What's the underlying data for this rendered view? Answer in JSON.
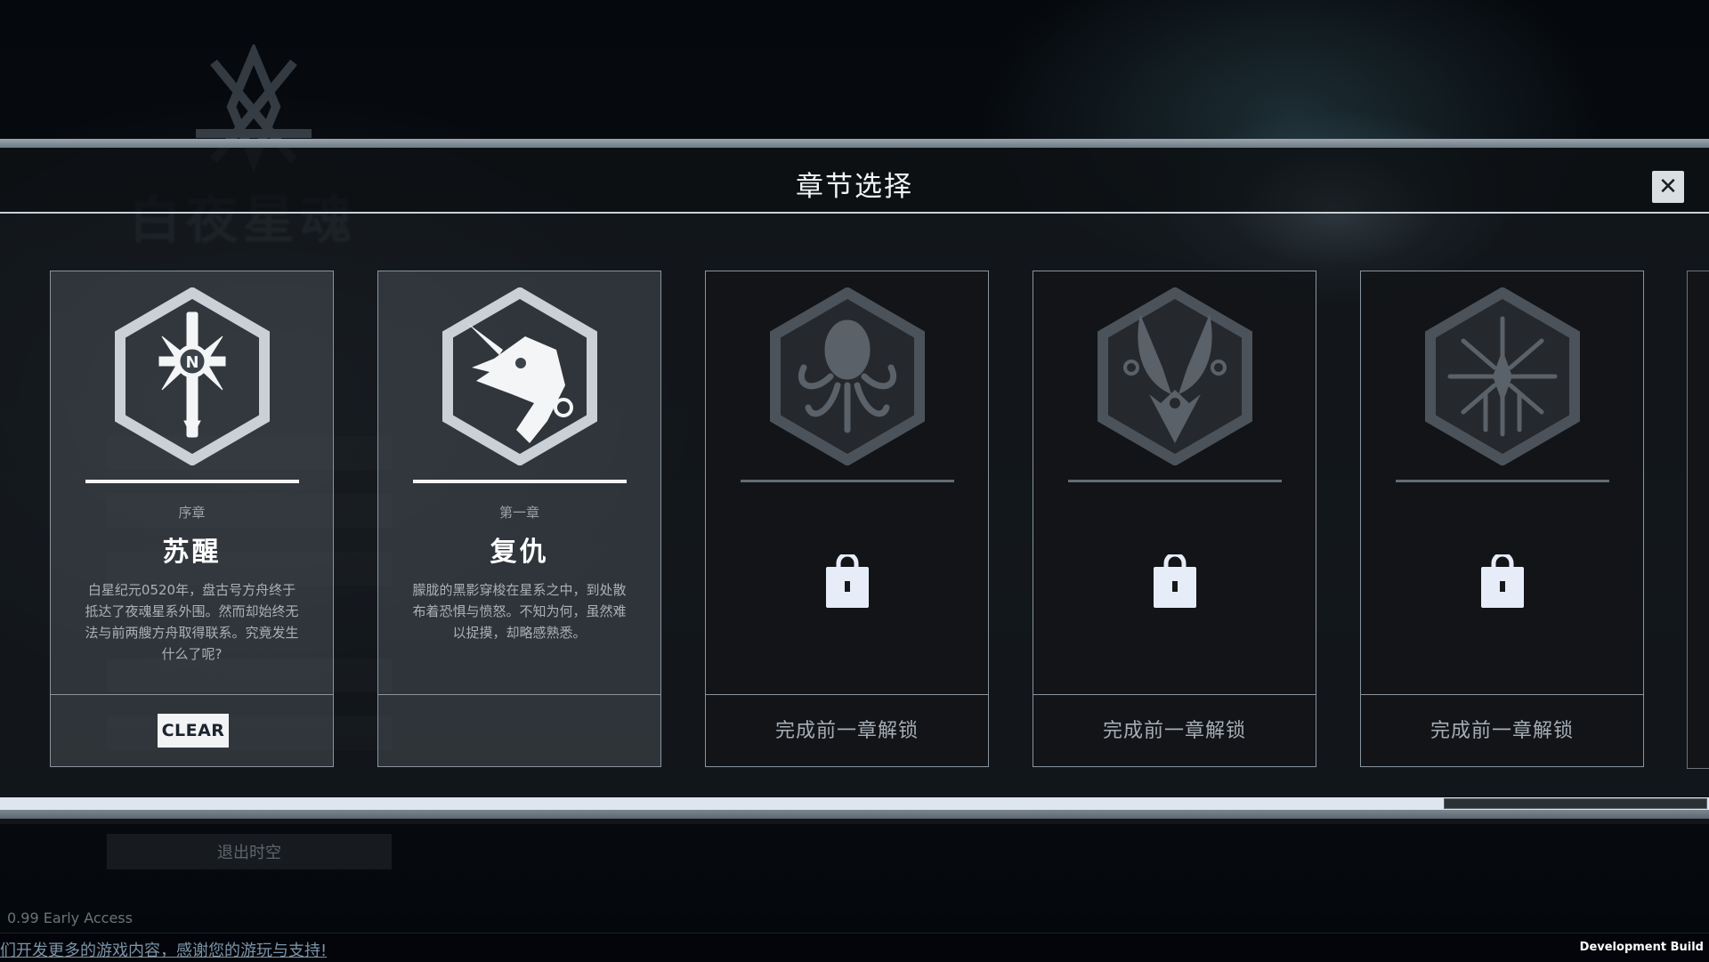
{
  "modal": {
    "title": "章节选择",
    "close_icon": "close-icon"
  },
  "chapters": [
    {
      "label": "序章",
      "name": "苏醒",
      "description": "白星纪元0520年，盘古号方舟终于抵达了夜魂星系外围。然而却始终无法与前两艘方舟取得联系。究竟发生什么了呢?",
      "status": "CLEAR",
      "emblem": "compass-sword-emblem",
      "locked": false
    },
    {
      "label": "第一章",
      "name": "复仇",
      "description": "朦胧的黑影穿梭在星系之中，到处散布着恐惧与愤怒。不知为何，虽然难以捉摸，却略感熟悉。",
      "status": "",
      "emblem": "unicorn-dragon-emblem",
      "locked": false
    },
    {
      "unlock_hint": "完成前一章解锁",
      "emblem": "octopus-emblem",
      "locked": true
    },
    {
      "unlock_hint": "完成前一章解锁",
      "emblem": "horned-beast-emblem",
      "locked": true
    },
    {
      "unlock_hint": "完成前一章解锁",
      "emblem": "spider-emblem",
      "locked": true
    }
  ],
  "background": {
    "exit_label": "退出时空",
    "version": "0.99 Early Access",
    "marquee": "们开发更多的游戏内容，感谢您的游玩与支持!",
    "dev_build": "Development Build"
  },
  "colors": {
    "accent_light": "#f4f6f8",
    "locked_icon": "#e6edf8",
    "modal_border": "#8a949d"
  }
}
